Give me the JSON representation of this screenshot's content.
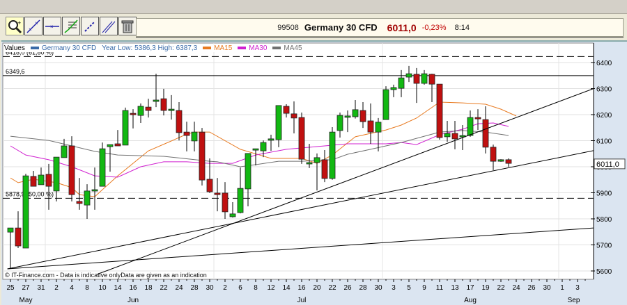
{
  "toolbar": {
    "tools": [
      {
        "name": "zoom-tool",
        "icon": "magnifier-icon"
      },
      {
        "name": "trendline-tool",
        "icon": "trendline-icon"
      },
      {
        "name": "horizontal-line-tool",
        "icon": "horizontal-line-icon"
      },
      {
        "name": "fibonacci-tool",
        "icon": "fibonacci-icon"
      },
      {
        "name": "parallel-channel-tool",
        "icon": "channel-icon"
      },
      {
        "name": "cross-line-tool",
        "icon": "cross-line-icon"
      },
      {
        "name": "delete-tool",
        "icon": "trash-icon"
      }
    ]
  },
  "header": {
    "code": "99508",
    "name": "Germany 30 CFD",
    "price": "6011,0",
    "change": "-0,23%",
    "time": "8:14"
  },
  "legend": {
    "values": "Values",
    "instrument": "Germany 30 CFD",
    "range": "Year Low: 5386,3 High: 6387,3",
    "ma15": "MA15",
    "ma30": "MA30",
    "ma45": "MA45"
  },
  "colors": {
    "up": "#12b812",
    "down": "#c01010",
    "ma15": "#e87a20",
    "ma30": "#d020d0",
    "ma45": "#707070",
    "instrument": "#3a6aa8"
  },
  "copyright": "© IT-Finance.com - Data is indicative onlyData are given as an indication",
  "chart_data": {
    "type": "candlestick",
    "title": "Germany 30 CFD",
    "ylim": [
      5560,
      6440
    ],
    "yticks": [
      5600,
      5700,
      5800,
      5900,
      6000,
      6100,
      6200,
      6300,
      6400
    ],
    "last_price_label": "6011,0",
    "hlines": [
      {
        "price": 6349.6,
        "label": "6349,6",
        "style": "solid"
      },
      {
        "price": 5878.9,
        "label": "5878,9 (50,00 %)",
        "style": "dashed"
      },
      {
        "price": 6423,
        "label": "6418,0 (61,80 %)",
        "style": "dashed"
      }
    ],
    "trendlines": [
      {
        "from": [
          -0.4,
          5608
        ],
        "to": [
          76.1,
          5765
        ]
      },
      {
        "from": [
          -0.4,
          5608
        ],
        "to": [
          76.1,
          6062
        ]
      },
      {
        "from": [
          11.3,
          5587
        ],
        "to": [
          76.1,
          6300
        ]
      }
    ],
    "xticks": [
      {
        "i": 0,
        "label": "25"
      },
      {
        "i": 2,
        "label": "27"
      },
      {
        "i": 4,
        "label": "31"
      },
      {
        "i": 6,
        "label": "2"
      },
      {
        "i": 8,
        "label": "4"
      },
      {
        "i": 10,
        "label": "8"
      },
      {
        "i": 12,
        "label": "10"
      },
      {
        "i": 14,
        "label": "14"
      },
      {
        "i": 16,
        "label": "16"
      },
      {
        "i": 18,
        "label": "18"
      },
      {
        "i": 20,
        "label": "22"
      },
      {
        "i": 22,
        "label": "24"
      },
      {
        "i": 24,
        "label": "28"
      },
      {
        "i": 26,
        "label": "30"
      },
      {
        "i": 28,
        "label": "2"
      },
      {
        "i": 30,
        "label": "6"
      },
      {
        "i": 32,
        "label": "8"
      },
      {
        "i": 34,
        "label": "12"
      },
      {
        "i": 36,
        "label": "14"
      },
      {
        "i": 38,
        "label": "16"
      },
      {
        "i": 40,
        "label": "20"
      },
      {
        "i": 42,
        "label": "22"
      },
      {
        "i": 44,
        "label": "26"
      },
      {
        "i": 46,
        "label": "28"
      },
      {
        "i": 48,
        "label": "30"
      },
      {
        "i": 50,
        "label": "3"
      },
      {
        "i": 52,
        "label": "5"
      },
      {
        "i": 54,
        "label": "9"
      },
      {
        "i": 56,
        "label": "11"
      },
      {
        "i": 58,
        "label": "13"
      },
      {
        "i": 60,
        "label": "17"
      },
      {
        "i": 62,
        "label": "19"
      },
      {
        "i": 64,
        "label": "22"
      },
      {
        "i": 66,
        "label": "24"
      },
      {
        "i": 68,
        "label": "26"
      },
      {
        "i": 70,
        "label": "30"
      },
      {
        "i": 72,
        "label": "1"
      },
      {
        "i": 74,
        "label": "3"
      }
    ],
    "months": [
      {
        "i": 2,
        "label": "May"
      },
      {
        "i": 16,
        "label": "Jun"
      },
      {
        "i": 38,
        "label": "Jul"
      },
      {
        "i": 60,
        "label": "Aug"
      },
      {
        "i": 73.5,
        "label": "Sep"
      }
    ],
    "month_gridlines": [
      5,
      27,
      49,
      72
    ],
    "candles": [
      [
        5749,
        5765,
        5608,
        5765
      ],
      [
        5765,
        5829,
        5688,
        5696
      ],
      [
        5688,
        5973,
        5688,
        5965
      ],
      [
        5963,
        5984,
        5925,
        5925
      ],
      [
        5931,
        5997,
        5931,
        5968
      ],
      [
        5971,
        6011,
        5835,
        5925
      ],
      [
        5907,
        6037,
        5867,
        6037
      ],
      [
        6035,
        6107,
        6035,
        6080
      ],
      [
        6080,
        6117,
        5867,
        5893
      ],
      [
        5867,
        5957,
        5835,
        5859
      ],
      [
        5853,
        5933,
        5800,
        5907
      ],
      [
        5909,
        5997,
        5835,
        5912
      ],
      [
        5925,
        6093,
        5925,
        6069
      ],
      [
        6077,
        6085,
        5981,
        6085
      ],
      [
        6088,
        6141,
        6080,
        6080
      ],
      [
        6083,
        6227,
        6083,
        6216
      ],
      [
        6205,
        6221,
        6147,
        6200
      ],
      [
        6197,
        6243,
        6168,
        6232
      ],
      [
        6229,
        6261,
        6189,
        6216
      ],
      [
        6253,
        6357,
        6229,
        6256
      ],
      [
        6261,
        6299,
        6197,
        6216
      ],
      [
        6216,
        6275,
        6181,
        6221
      ],
      [
        6216,
        6248,
        6101,
        6131
      ],
      [
        6133,
        6173,
        6059,
        6120
      ],
      [
        6099,
        6173,
        6059,
        6133
      ],
      [
        6133,
        6149,
        5928,
        5949
      ],
      [
        5952,
        6032,
        5899,
        5904
      ],
      [
        5899,
        5957,
        5829,
        5893
      ],
      [
        5899,
        5941,
        5800,
        5827
      ],
      [
        5808,
        5864,
        5805,
        5819
      ],
      [
        5824,
        5997,
        5821,
        5917
      ],
      [
        5915,
        6051,
        5848,
        6051
      ],
      [
        6069,
        6069,
        6005,
        6069
      ],
      [
        6061,
        6101,
        6037,
        6093
      ],
      [
        6107,
        6123,
        6061,
        6107
      ],
      [
        6104,
        6235,
        6075,
        6235
      ],
      [
        6232,
        6240,
        6189,
        6205
      ],
      [
        6203,
        6251,
        6128,
        6187
      ],
      [
        6189,
        6208,
        6011,
        6029
      ],
      [
        6016,
        6088,
        5995,
        6016
      ],
      [
        6016,
        6051,
        5909,
        6035
      ],
      [
        6027,
        6064,
        5941,
        5955
      ],
      [
        5955,
        6152,
        5950,
        6133
      ],
      [
        6139,
        6208,
        6112,
        6197
      ],
      [
        6195,
        6216,
        6133,
        6195
      ],
      [
        6192,
        6256,
        6185,
        6219
      ],
      [
        6216,
        6248,
        6149,
        6173
      ],
      [
        6176,
        6243,
        6088,
        6133
      ],
      [
        6133,
        6187,
        6059,
        6171
      ],
      [
        6181,
        6309,
        6181,
        6296
      ],
      [
        6296,
        6315,
        6267,
        6304
      ],
      [
        6301,
        6371,
        6267,
        6341
      ],
      [
        6344,
        6387,
        6325,
        6357
      ],
      [
        6355,
        6379,
        6245,
        6320
      ],
      [
        6320,
        6371,
        6315,
        6357
      ],
      [
        6355,
        6357,
        6248,
        6317
      ],
      [
        6317,
        6317,
        6104,
        6112
      ],
      [
        6115,
        6176,
        6096,
        6128
      ],
      [
        6128,
        6176,
        6067,
        6107
      ],
      [
        6115,
        6160,
        6064,
        6120
      ],
      [
        6120,
        6216,
        6115,
        6189
      ],
      [
        6189,
        6221,
        6141,
        6184
      ],
      [
        6181,
        6232,
        6051,
        6075
      ],
      [
        6075,
        6085,
        5987,
        6021
      ],
      [
        6021,
        6029,
        6019,
        6027
      ],
      [
        6027,
        6032,
        6000,
        6013
      ]
    ],
    "candle_format": [
      "open",
      "high",
      "low",
      "close"
    ],
    "series": [
      {
        "name": "MA15",
        "points": [
          [
            0,
            5957
          ],
          [
            1,
            5939
          ],
          [
            3,
            5952
          ],
          [
            6,
            5939
          ],
          [
            8,
            5920
          ],
          [
            9,
            5893
          ],
          [
            11,
            5885
          ],
          [
            12,
            5912
          ],
          [
            14,
            5965
          ],
          [
            16,
            6013
          ],
          [
            18,
            6061
          ],
          [
            21,
            6099
          ],
          [
            23,
            6125
          ],
          [
            24,
            6133
          ],
          [
            26,
            6133
          ],
          [
            30,
            6067
          ],
          [
            34,
            6032
          ],
          [
            38,
            6032
          ],
          [
            40,
            6013
          ],
          [
            42,
            6045
          ],
          [
            45,
            6115
          ],
          [
            49,
            6141
          ],
          [
            51,
            6160
          ],
          [
            53,
            6187
          ],
          [
            56,
            6248
          ],
          [
            59,
            6245
          ],
          [
            62,
            6240
          ],
          [
            64,
            6221
          ],
          [
            66,
            6195
          ]
        ]
      },
      {
        "name": "MA30",
        "points": [
          [
            0,
            6080
          ],
          [
            2,
            6045
          ],
          [
            5,
            6027
          ],
          [
            8,
            6000
          ],
          [
            11,
            5965
          ],
          [
            14,
            5960
          ],
          [
            17,
            6000
          ],
          [
            20,
            6019
          ],
          [
            23,
            6019
          ],
          [
            26,
            6013
          ],
          [
            29,
            6013
          ],
          [
            32,
            6045
          ],
          [
            36,
            6067
          ],
          [
            41,
            6080
          ],
          [
            44,
            6088
          ],
          [
            49,
            6088
          ],
          [
            51,
            6093
          ],
          [
            53,
            6085
          ],
          [
            56,
            6123
          ],
          [
            59,
            6144
          ],
          [
            61,
            6165
          ],
          [
            63,
            6168
          ],
          [
            65,
            6155
          ]
        ]
      },
      {
        "name": "MA45",
        "points": [
          [
            0,
            6117
          ],
          [
            5,
            6101
          ],
          [
            8,
            6080
          ],
          [
            11,
            6059
          ],
          [
            14,
            6045
          ],
          [
            20,
            6040
          ],
          [
            26,
            6021
          ],
          [
            27,
            6019
          ],
          [
            30,
            6000
          ],
          [
            32,
            6008
          ],
          [
            35,
            6021
          ],
          [
            38,
            6021
          ],
          [
            42,
            6027
          ],
          [
            44,
            6048
          ],
          [
            47,
            6067
          ],
          [
            51,
            6093
          ],
          [
            56,
            6133
          ],
          [
            59,
            6139
          ],
          [
            62,
            6133
          ],
          [
            65,
            6120
          ]
        ]
      }
    ]
  }
}
